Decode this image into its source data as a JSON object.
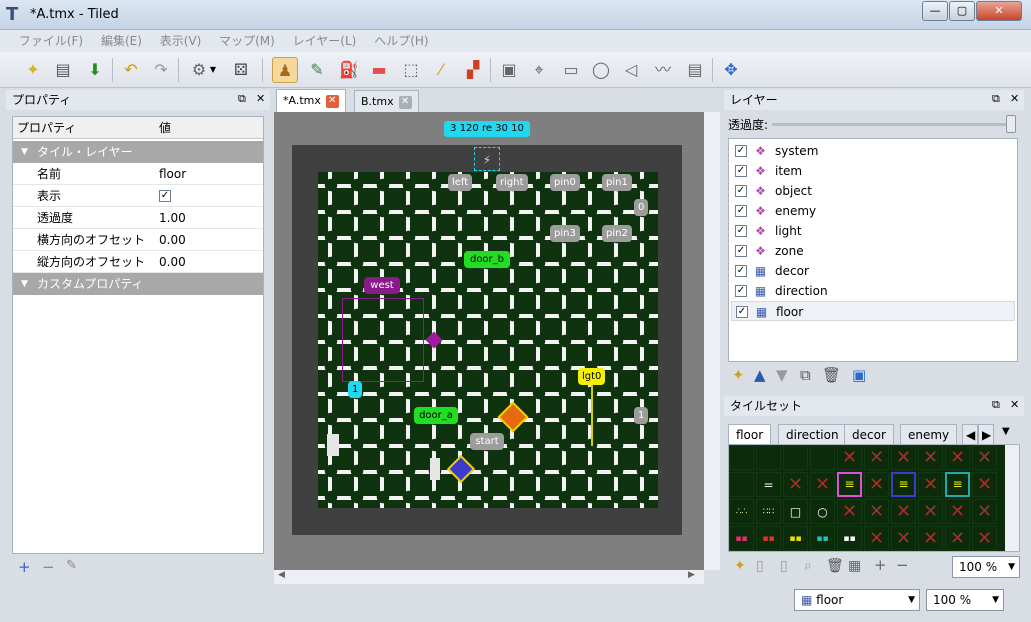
{
  "window": {
    "title": "*A.tmx - Tiled",
    "controls": [
      "—",
      "▢",
      "✕"
    ]
  },
  "menu": [
    "ファイル(F)",
    "編集(E)",
    "表示(V)",
    "マップ(M)",
    "レイヤー(L)",
    "ヘルプ(H)"
  ],
  "properties_panel": {
    "title": "プロパティ",
    "col_property": "プロパティ",
    "col_value": "値",
    "group_tile_layer": "タイル・レイヤー",
    "rows": [
      {
        "key": "名前",
        "value": "floor"
      },
      {
        "key": "表示",
        "value": "✓"
      },
      {
        "key": "透過度",
        "value": "1.00"
      },
      {
        "key": "横方向のオフセット",
        "value": "0.00"
      },
      {
        "key": "縦方向のオフセット",
        "value": "0.00"
      }
    ],
    "group_custom": "カスタムプロパティ",
    "footer": [
      "+",
      "−",
      "✎"
    ]
  },
  "doc_tabs": [
    {
      "label": "*A.tmx",
      "active": true
    },
    {
      "label": "B.tmx",
      "active": false
    }
  ],
  "map": {
    "top_label": "3 120 re 30 10",
    "objects": [
      {
        "name": "left",
        "color": "#9c9c9c"
      },
      {
        "name": "right",
        "color": "#9c9c9c"
      },
      {
        "name": "pin0",
        "color": "#9c9c9c"
      },
      {
        "name": "pin1",
        "color": "#9c9c9c"
      },
      {
        "name": "0",
        "color": "#9c9c9c"
      },
      {
        "name": "pin3",
        "color": "#9c9c9c"
      },
      {
        "name": "pin2",
        "color": "#9c9c9c"
      },
      {
        "name": "door_b",
        "color": "#22dd22"
      },
      {
        "name": "west",
        "color": "#8a1a8a"
      },
      {
        "name": "1",
        "color": "#22d8f0"
      },
      {
        "name": "lgt0",
        "color": "#f4f000"
      },
      {
        "name": "door_a",
        "color": "#22dd22"
      },
      {
        "name": "1",
        "color": "#9c9c9c"
      },
      {
        "name": "start",
        "color": "#9c9c9c"
      }
    ]
  },
  "layers_panel": {
    "title": "レイヤー",
    "opacity_label": "透過度:",
    "layers": [
      {
        "name": "system",
        "type": "object"
      },
      {
        "name": "item",
        "type": "object"
      },
      {
        "name": "object",
        "type": "object"
      },
      {
        "name": "enemy",
        "type": "object"
      },
      {
        "name": "light",
        "type": "object"
      },
      {
        "name": "zone",
        "type": "object"
      },
      {
        "name": "decor",
        "type": "tile"
      },
      {
        "name": "direction",
        "type": "tile"
      },
      {
        "name": "floor",
        "type": "tile",
        "selected": true
      }
    ]
  },
  "tileset_panel": {
    "title": "タイルセット",
    "tabs": [
      "floor",
      "direction",
      "decor",
      "enemy"
    ],
    "zoom": "100 %"
  },
  "status": {
    "layer_combo": "floor",
    "zoom_combo": "100 %"
  },
  "colors": {
    "accent_cyan": "#22d8f0",
    "door_green": "#22dd22",
    "west_purple": "#8a1a8a",
    "light_yellow": "#f4f000",
    "map_bg": "#0f330f"
  }
}
